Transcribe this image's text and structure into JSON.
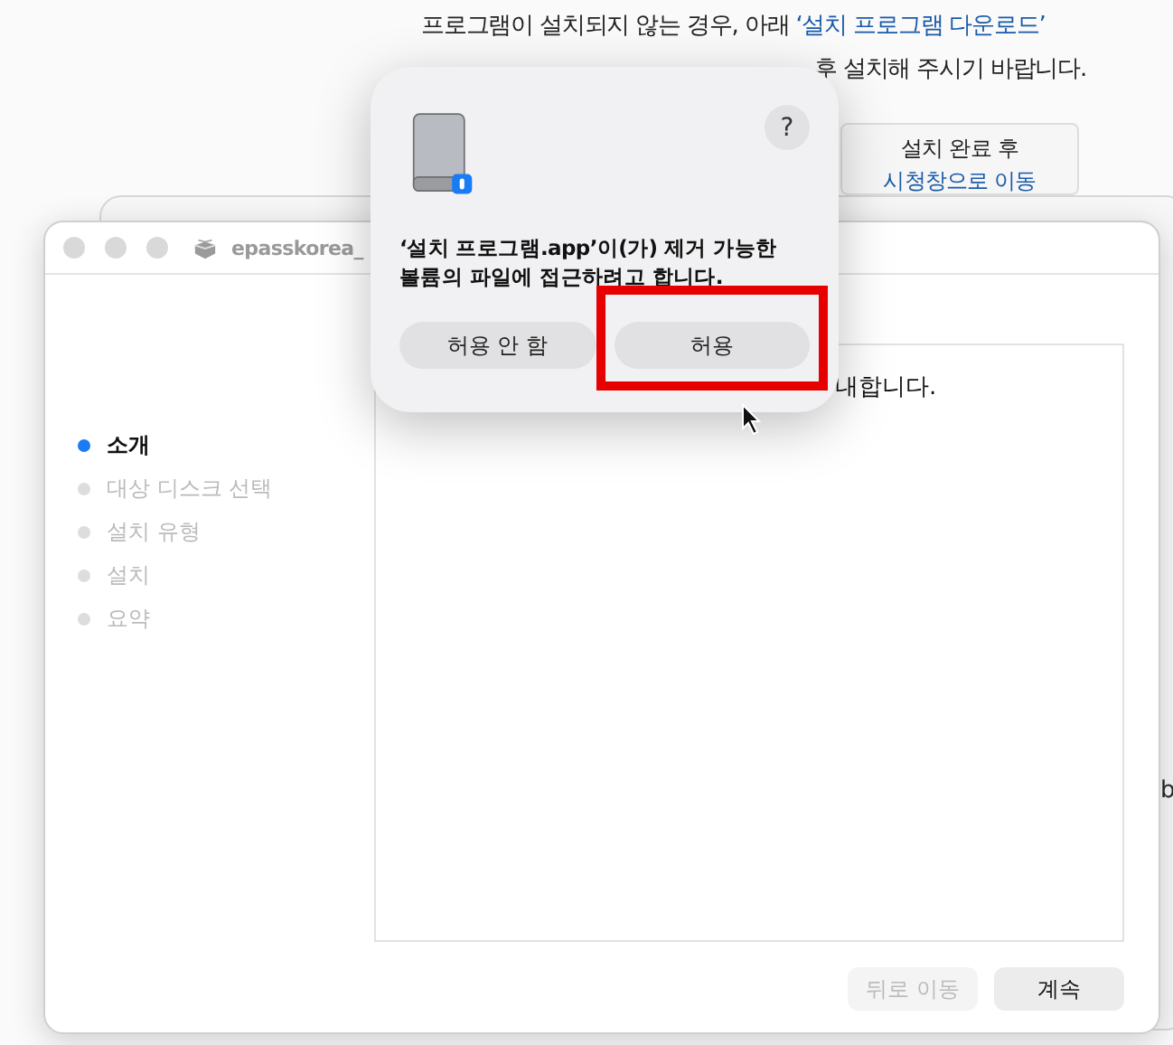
{
  "web_page": {
    "notice_line_1": [
      {
        "kind": "plain",
        "text": "프로그램이 설치되지 않는 경우, 아래 "
      },
      {
        "kind": "link",
        "text": "‘설치 프로그램 다운로드’"
      }
    ],
    "notice_line_2": "후 설치해 주시기 바랍니다.",
    "notice_button": {
      "line_1": "설치 완료 후",
      "line_2": "시청창으로 이동"
    },
    "edge_letters": [
      "b"
    ]
  },
  "installer": {
    "title": "epasskorea_",
    "steps": [
      {
        "label": "소개",
        "selected": true
      },
      {
        "label": "대상 디스크 선택",
        "selected": false
      },
      {
        "label": "설치 유형",
        "selected": false
      },
      {
        "label": "설치",
        "selected": false
      },
      {
        "label": "요약",
        "selected": false
      }
    ],
    "content_text": "내합니다.",
    "buttons": [
      {
        "label": "뒤로 이동",
        "disabled": true
      },
      {
        "label": "계속",
        "disabled": false
      }
    ]
  },
  "permission_dialog": {
    "help": "?",
    "message_lines": [
      "‘설치 프로그램.app’이(가) 제거 가능한",
      "볼륨의 파일에 접근하려고 합니다."
    ],
    "buttons": [
      {
        "label": "허용 안 함",
        "highlighted": false
      },
      {
        "label": "허용",
        "highlighted": true
      }
    ]
  }
}
